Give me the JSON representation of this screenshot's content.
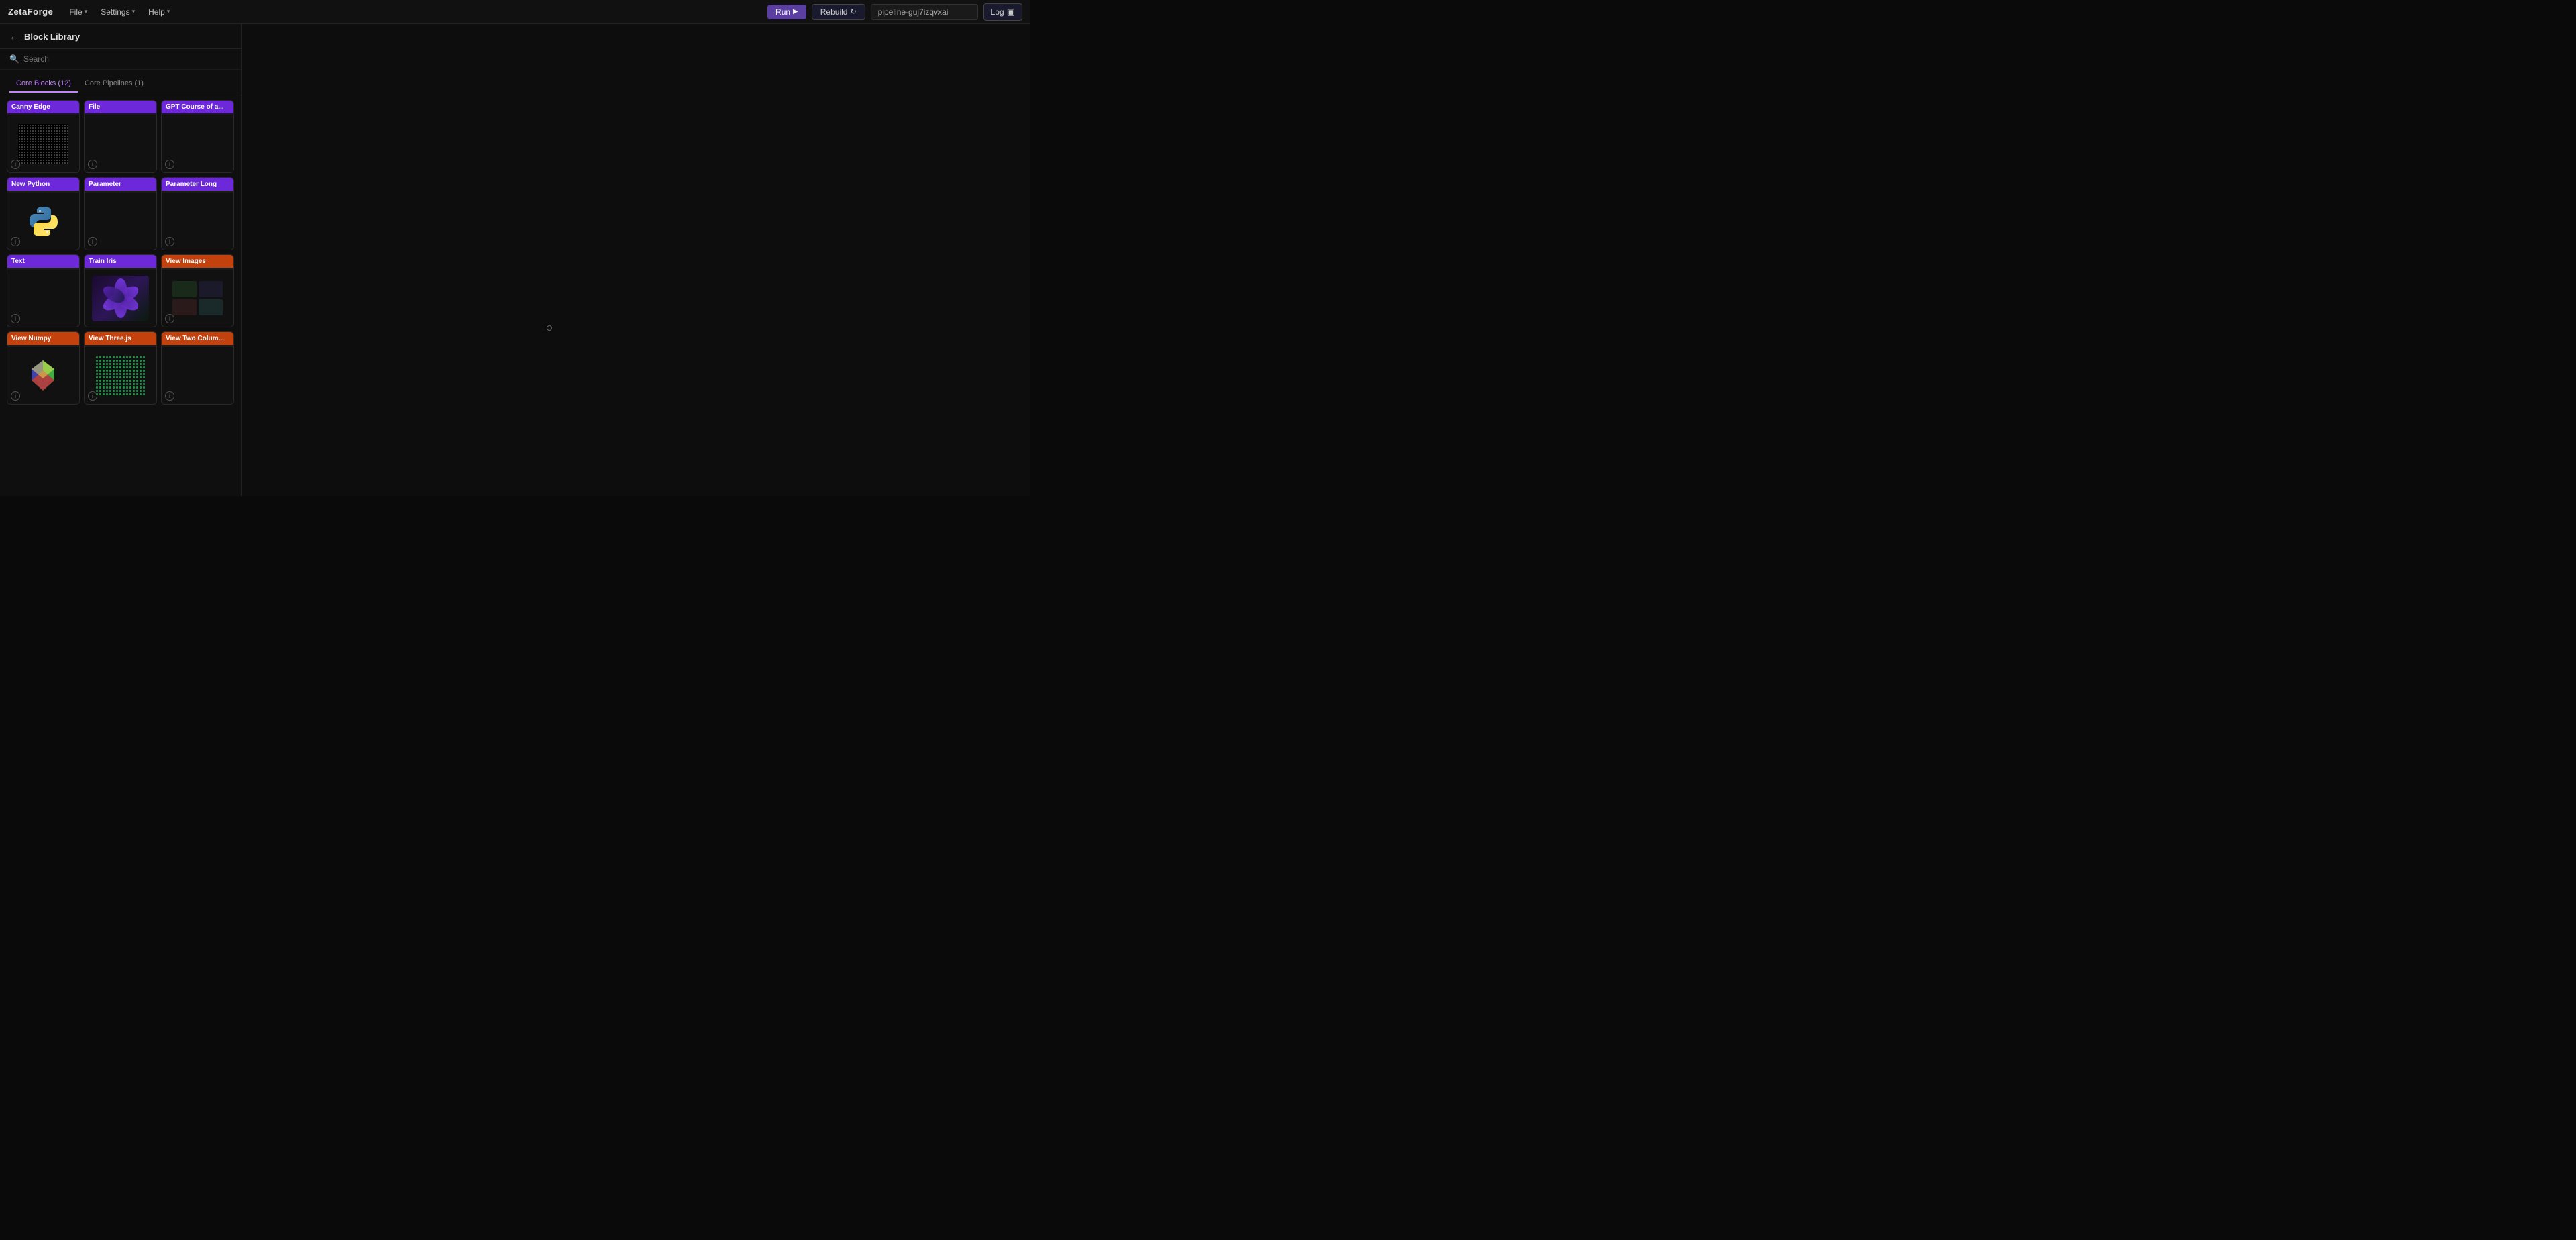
{
  "brand": "ZetaForge",
  "nav": {
    "menus": [
      {
        "label": "File",
        "id": "file-menu"
      },
      {
        "label": "Settings",
        "id": "settings-menu"
      },
      {
        "label": "Help",
        "id": "help-menu"
      }
    ]
  },
  "toolbar": {
    "run_label": "Run",
    "rebuild_label": "Rebuild",
    "log_label": "Log",
    "pipeline_name": "pipeline-guj7izqvxai"
  },
  "sidebar": {
    "title": "Block Library",
    "search_placeholder": "Search",
    "tabs": [
      {
        "label": "Core Blocks (12)",
        "active": true
      },
      {
        "label": "Core Pipelines (1)",
        "active": false
      }
    ],
    "blocks": [
      {
        "label": "Canny Edge",
        "color": "purple",
        "has_preview": true,
        "preview_type": "canny",
        "info": true
      },
      {
        "label": "File",
        "color": "purple",
        "has_preview": false,
        "preview_type": "empty",
        "info": true
      },
      {
        "label": "GPT Course of a...",
        "color": "purple",
        "has_preview": false,
        "preview_type": "empty",
        "info": true
      },
      {
        "label": "New Python",
        "color": "purple",
        "has_preview": true,
        "preview_type": "python",
        "info": true
      },
      {
        "label": "Parameter",
        "color": "purple",
        "has_preview": false,
        "preview_type": "empty",
        "info": true
      },
      {
        "label": "Parameter Long",
        "color": "purple",
        "has_preview": false,
        "preview_type": "empty",
        "info": true
      },
      {
        "label": "Text",
        "color": "purple",
        "has_preview": false,
        "preview_type": "empty",
        "info": true
      },
      {
        "label": "Train Iris",
        "color": "purple",
        "has_preview": true,
        "preview_type": "iris",
        "info": false
      },
      {
        "label": "View Images",
        "color": "orange",
        "has_preview": true,
        "preview_type": "view_images",
        "info": true
      },
      {
        "label": "View Numpy",
        "color": "orange",
        "has_preview": true,
        "preview_type": "numpy",
        "info": true
      },
      {
        "label": "View Three.js",
        "color": "orange",
        "has_preview": true,
        "preview_type": "threejs",
        "info": true
      },
      {
        "label": "View Two Colum...",
        "color": "orange",
        "has_preview": false,
        "preview_type": "empty",
        "info": true
      }
    ]
  }
}
